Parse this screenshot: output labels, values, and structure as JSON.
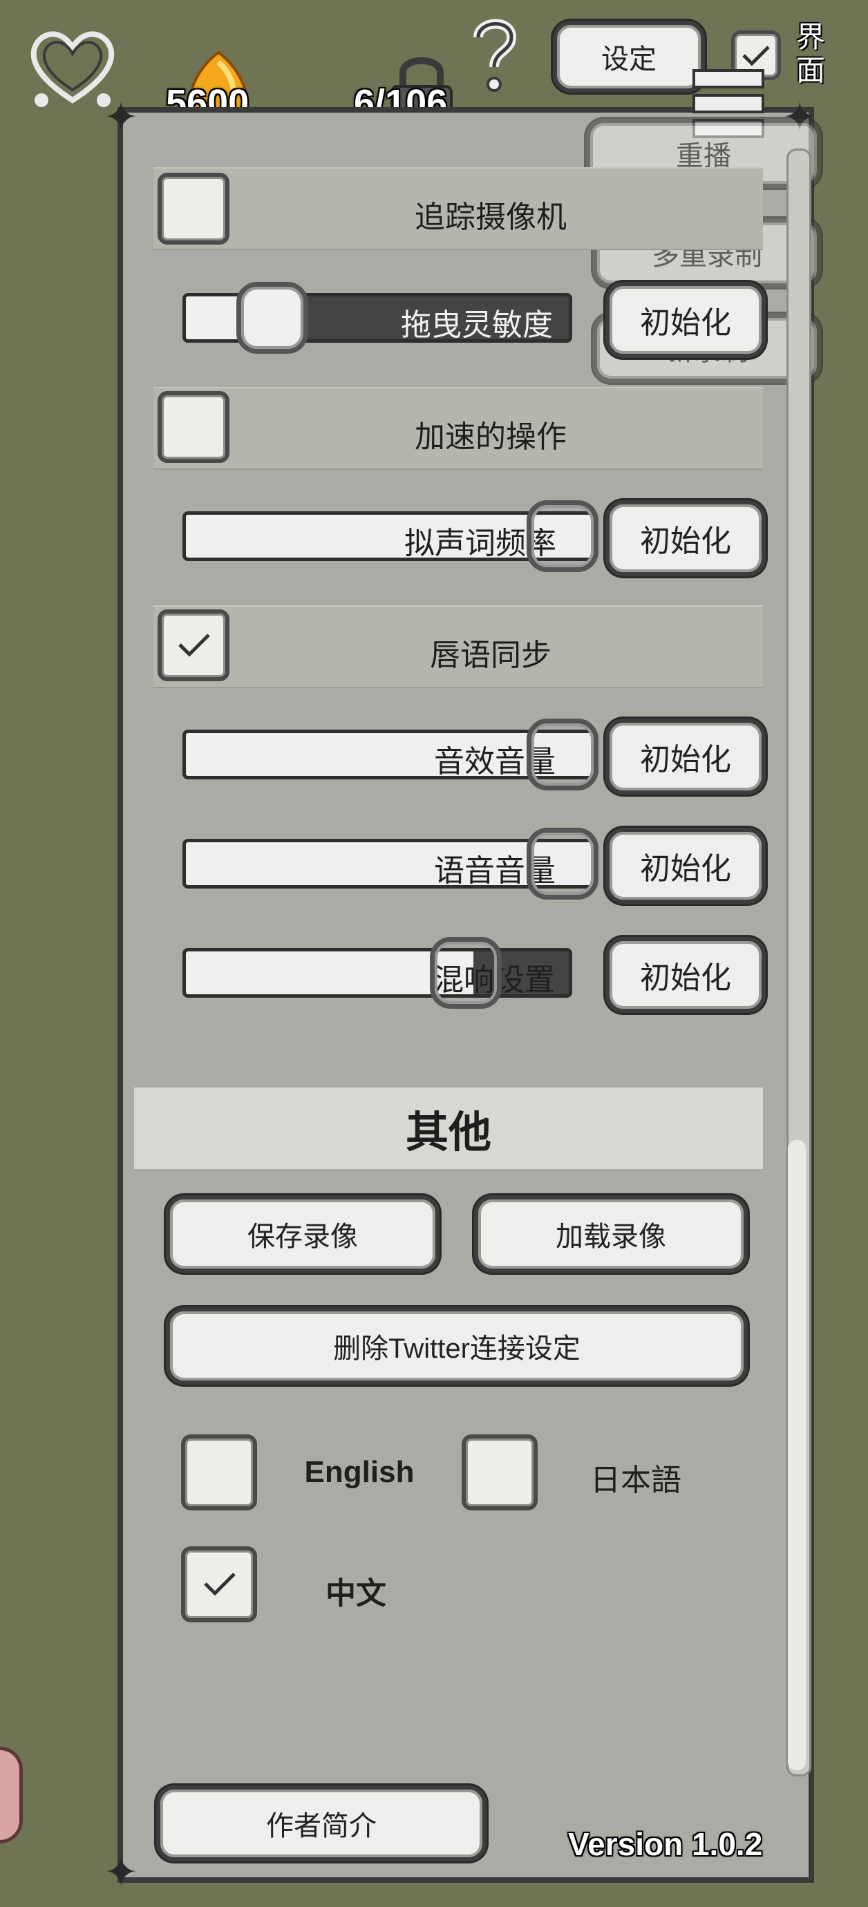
{
  "hud": {
    "currency_value": "5600",
    "progress_value": "6/106",
    "settings_label": "设定",
    "ui_toggle_label": "界面"
  },
  "side_menu": {
    "replay_label": "重播",
    "multi_record_label": "多重录制",
    "new_record_label": "新录制"
  },
  "settings": {
    "tracking_camera_label": "追踪摄像机",
    "drag_sensitivity_label": "拖曳灵敏度",
    "speed_operation_label": "加速的操作",
    "onomatopoeia_label": "拟声词频率",
    "lip_sync_label": "唇语同步",
    "sfx_volume_label": "音效音量",
    "voice_volume_label": "语音音量",
    "reverb_label": "混响设置",
    "init_label": "初始化",
    "drag_sensitivity_value": 0.2,
    "onomatopoeia_value": 1.0,
    "sfx_volume_value": 1.0,
    "voice_volume_value": 1.0,
    "reverb_value": 0.75
  },
  "other": {
    "title": "其他",
    "save_recording_label": "保存录像",
    "load_recording_label": "加载录像",
    "delete_twitter_label": "删除Twitter连接设定",
    "lang_english": "English",
    "lang_japanese": "日本語",
    "lang_chinese": "中文",
    "author_profile_label": "作者简介",
    "version_text": "Version 1.0.2"
  },
  "checkbox_states": {
    "tracking_camera": false,
    "speed_operation": false,
    "lip_sync": true,
    "english": false,
    "japanese": false,
    "chinese": true,
    "ui_toggle": true
  },
  "colors": {
    "background": "#6f7455",
    "panel": "#a9aca4",
    "border": "#3a3a3a"
  }
}
